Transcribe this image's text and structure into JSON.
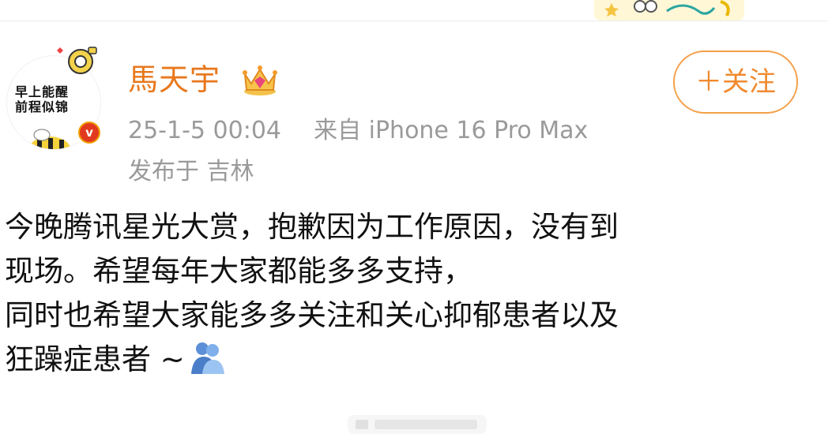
{
  "header": {
    "username": "馬天宇",
    "follow_label": "＋关注",
    "timestamp": "25-1-5 00:04",
    "source": "来自 iPhone 16 Pro Max",
    "location": "发布于 吉林"
  },
  "avatar": {
    "text_line1": "早上能醒",
    "text_line2": "前程似锦",
    "verify_label": "v"
  },
  "post": {
    "lines": [
      "今晚腾讯星光大赏，抱歉因为工作原因，没有到",
      "现场。希望每年大家都能多多支持，",
      "同时也希望大家能多多关注和关心抑郁患者以及",
      "狂躁症患者 ~"
    ]
  },
  "icons": {
    "verify": "verified-v-badge-icon",
    "crown": "crown-icon",
    "emoji": "hug-emoji-icon"
  },
  "colors": {
    "username": "#e8781c",
    "follow": "#f08a30",
    "meta": "#9a9a9a",
    "text": "#111111"
  }
}
